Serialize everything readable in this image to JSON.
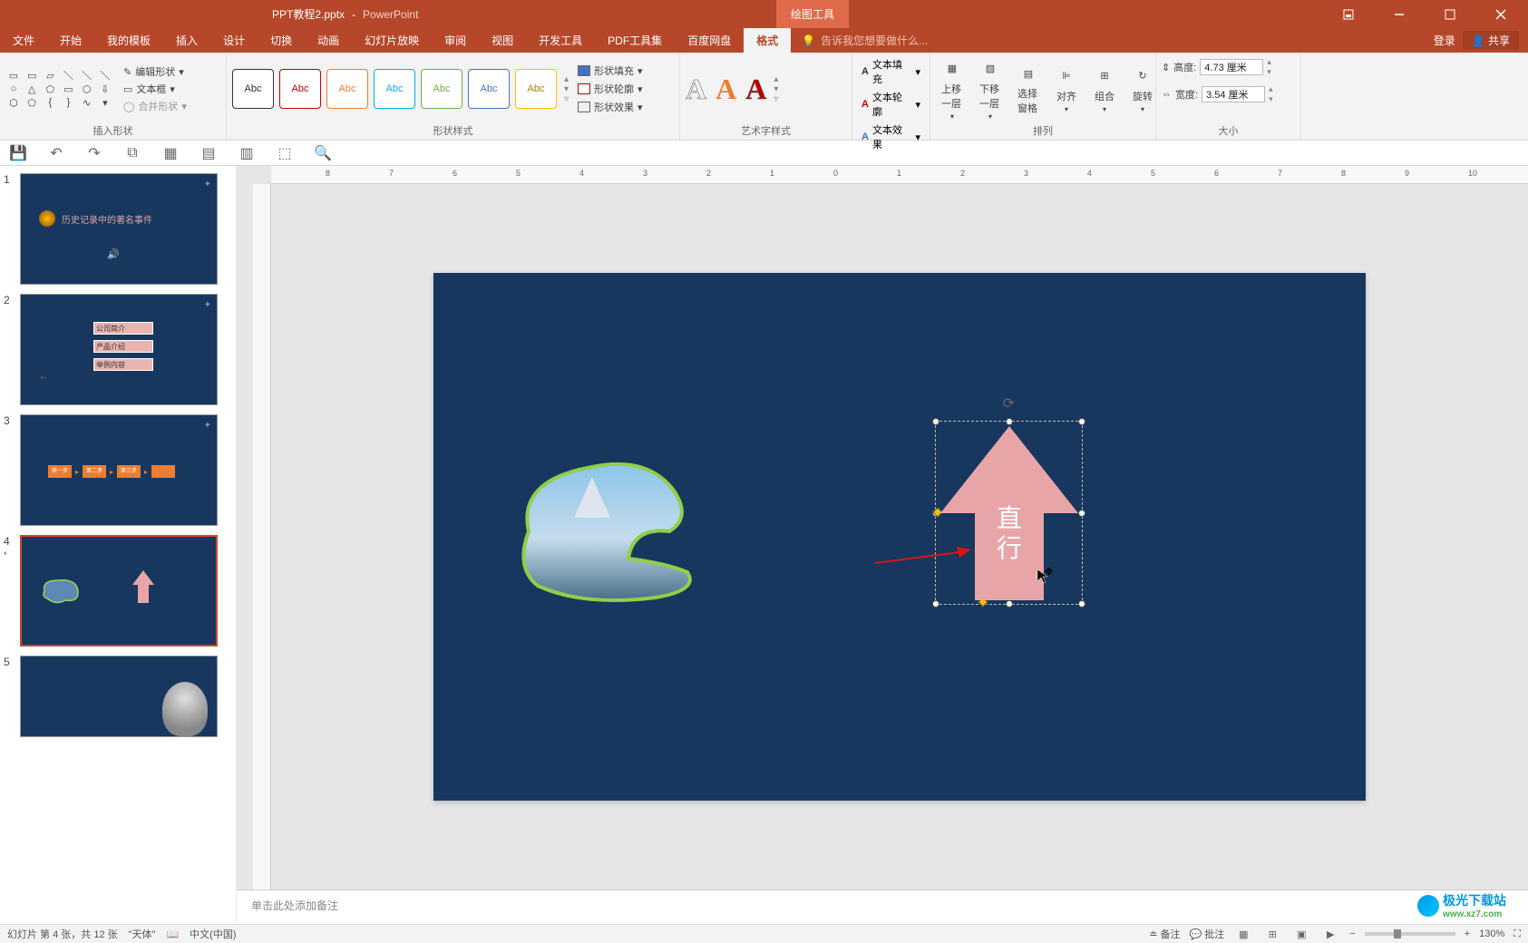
{
  "title": {
    "doc": "PPT教程2.pptx",
    "app": "PowerPoint",
    "tool_tab": "绘图工具"
  },
  "win": {
    "login": "登录",
    "share": "共享"
  },
  "menu": {
    "items": [
      "文件",
      "开始",
      "我的模板",
      "插入",
      "设计",
      "切换",
      "动画",
      "幻灯片放映",
      "审阅",
      "视图",
      "开发工具",
      "PDF工具集",
      "百度网盘",
      "格式"
    ],
    "active_index": 13,
    "tell_me": "告诉我您想要做什么..."
  },
  "ribbon": {
    "g1": {
      "label": "插入形状",
      "edit_shape": "编辑形状",
      "text_box": "文本框",
      "merge_shapes": "合并形状"
    },
    "g2": {
      "label": "形状样式",
      "preset_text": "Abc",
      "shape_fill": "形状填充",
      "shape_outline": "形状轮廓",
      "shape_effects": "形状效果"
    },
    "g3": {
      "label": "艺术字样式",
      "sample": "A",
      "text_fill": "文本填充",
      "text_outline": "文本轮廓",
      "text_effects": "文本效果"
    },
    "g4": {
      "label": "排列",
      "bring_fwd": "上移一层",
      "send_back": "下移一层",
      "sel_pane": "选择窗格",
      "align": "对齐",
      "group": "组合",
      "rotate": "旋转"
    },
    "g5": {
      "label": "大小",
      "height_lbl": "高度:",
      "height_val": "4.73 厘米",
      "width_lbl": "宽度:",
      "width_val": "3.54 厘米"
    }
  },
  "thumbs": {
    "t1_title": "历史记录中的著名事件",
    "t2_a": "公司简介",
    "t2_b": "产品介绍",
    "t2_c": "举例内容",
    "t3_a": "第一步",
    "t3_b": "第二步",
    "t3_c": "第三步"
  },
  "slide": {
    "arrow_text_1": "直",
    "arrow_text_2": "行"
  },
  "notes": {
    "placeholder": "单击此处添加备注"
  },
  "status": {
    "slide_info": "幻灯片 第 4 张，共 12 张",
    "theme": "\"天体\"",
    "lang": "中文(中国)",
    "notes": "备注",
    "comments": "批注",
    "zoom": "130%"
  },
  "watermark": {
    "text": "极光下载站",
    "url": "www.xz7.com"
  },
  "ruler_h": [
    -8,
    -7,
    -6,
    -5,
    -4,
    -3,
    -2,
    -1,
    0,
    1,
    2,
    3,
    4,
    5,
    6,
    7,
    8,
    9,
    10
  ]
}
